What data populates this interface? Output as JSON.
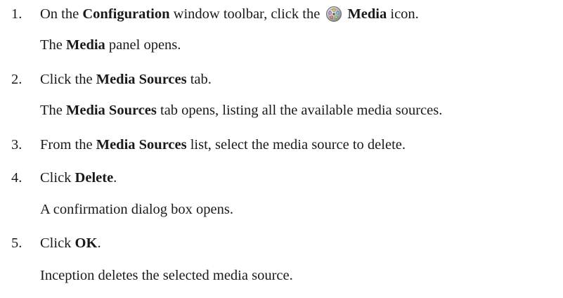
{
  "steps": [
    {
      "number": "1.",
      "parts": {
        "a": "On the ",
        "b_config": "Configuration",
        "c": " window toolbar, click the ",
        "d_media": "Media",
        "e": " icon."
      },
      "result_parts": {
        "a": "The ",
        "b_media": "Media",
        "c": " panel opens."
      },
      "icon": "media-reel-icon"
    },
    {
      "number": "2.",
      "parts": {
        "a": "Click the ",
        "b_ms": "Media Sources",
        "c": " tab."
      },
      "result_parts": {
        "a": "The ",
        "b_ms": "Media Sources",
        "c": " tab opens, listing all the available media sources."
      }
    },
    {
      "number": "3.",
      "parts": {
        "a": "From the ",
        "b_ms": "Media Sources",
        "c": " list, select the media source to delete."
      }
    },
    {
      "number": "4.",
      "parts": {
        "a": "Click ",
        "b_delete": "Delete",
        "c": "."
      },
      "result": "A confirmation dialog box opens."
    },
    {
      "number": "5.",
      "parts": {
        "a": "Click ",
        "b_ok": "OK",
        "c": "."
      },
      "result": "Inception deletes the selected media source."
    }
  ]
}
